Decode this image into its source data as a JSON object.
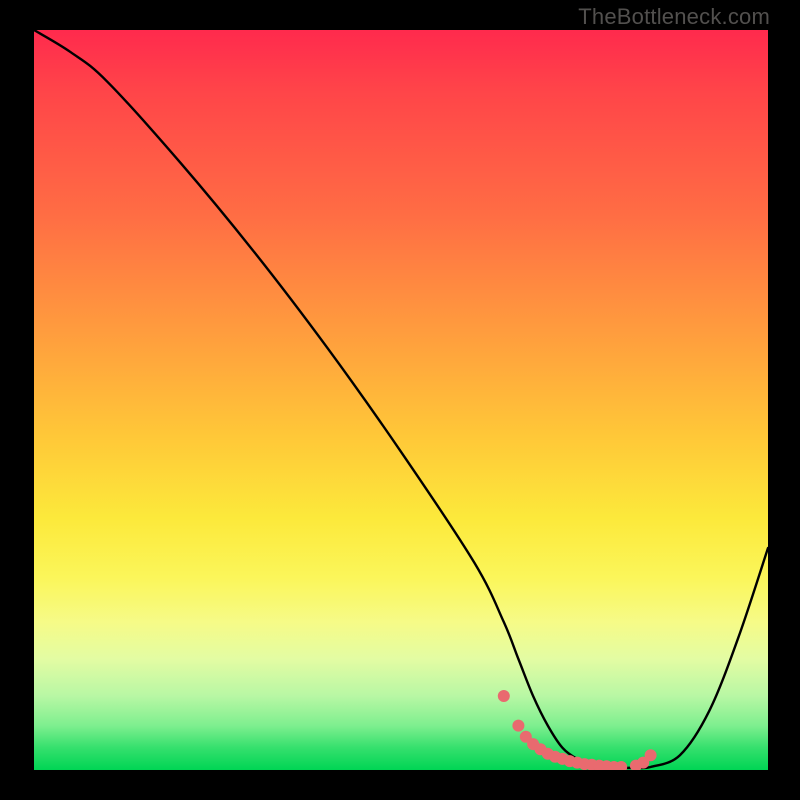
{
  "attribution": "TheBottleneck.com",
  "colors": {
    "background": "#000000",
    "gradient_top": "#ff2a4d",
    "gradient_mid": "#fce93b",
    "gradient_bottom": "#00d554",
    "curve": "#000000",
    "dots": "#e96a6f"
  },
  "chart_data": {
    "type": "line",
    "title": "",
    "xlabel": "",
    "ylabel": "",
    "xlim": [
      0,
      100
    ],
    "ylim": [
      0,
      100
    ],
    "grid": false,
    "legend": false,
    "series": [
      {
        "name": "bottleneck-curve",
        "x": [
          0,
          5,
          10,
          20,
          30,
          40,
          50,
          60,
          64,
          66,
          68,
          70,
          72,
          74,
          76,
          78,
          80,
          82,
          84,
          88,
          92,
          96,
          100
        ],
        "y": [
          100,
          97,
          93,
          82,
          70,
          57,
          43,
          28,
          20,
          15,
          10,
          6,
          3,
          1.5,
          0.8,
          0.4,
          0.3,
          0.3,
          0.4,
          2,
          8,
          18,
          30
        ]
      }
    ],
    "flat_region_dots": {
      "name": "flat-bottom-dots",
      "x": [
        64,
        66,
        67,
        68,
        69,
        70,
        71,
        72,
        73,
        74,
        75,
        76,
        77,
        78,
        79,
        80,
        82,
        83,
        84
      ],
      "y": [
        10,
        6,
        4.5,
        3.5,
        2.8,
        2.2,
        1.8,
        1.5,
        1.2,
        1.0,
        0.8,
        0.7,
        0.6,
        0.5,
        0.4,
        0.4,
        0.6,
        1.0,
        2.0
      ]
    }
  }
}
